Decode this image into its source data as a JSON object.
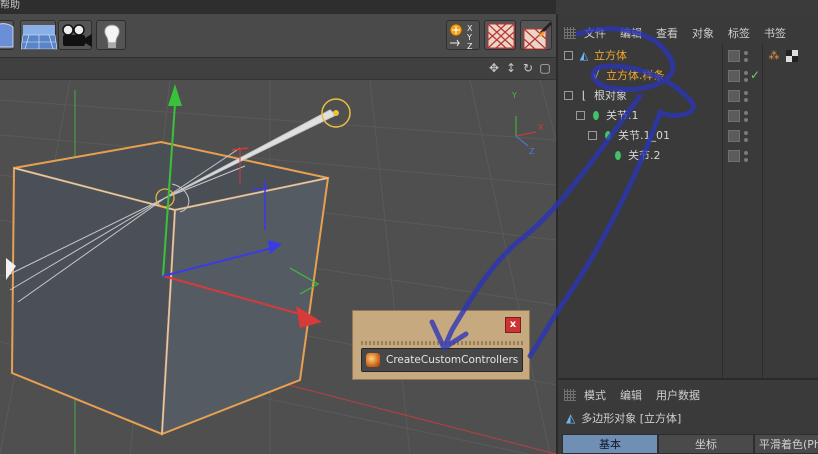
{
  "menubar": {
    "label": "帮助"
  },
  "viewport": {
    "axis_labels": {
      "x": "X",
      "y": "Y",
      "z": "Z"
    }
  },
  "object_manager": {
    "menu": [
      "文件",
      "编辑",
      "查看",
      "对象",
      "标签",
      "书签"
    ],
    "tree": [
      {
        "label": "立方体",
        "selected": true,
        "icon": "cube-icon"
      },
      {
        "label": "立方体.样条",
        "selected": true,
        "icon": "spline-icon",
        "checked": true
      },
      {
        "label": "根对象",
        "selected": false,
        "icon": "joint-root-icon"
      },
      {
        "label": "关节.1",
        "selected": false,
        "icon": "joint-icon"
      },
      {
        "label": "关节.1_01",
        "selected": false,
        "icon": "joint-icon"
      },
      {
        "label": "关节.2",
        "selected": false,
        "icon": "joint-icon"
      }
    ]
  },
  "attribute_manager": {
    "menu": [
      "模式",
      "编辑",
      "用户数据"
    ],
    "title": "多边形对象 [立方体]",
    "tabs": [
      "基本",
      "坐标",
      "平滑着色(Pho"
    ],
    "active_tab": "基本"
  },
  "dialog": {
    "close_label": "x",
    "button_label": "CreateCustomControllers"
  },
  "colors": {
    "accent_selected": "#f0a830",
    "active_tab": "#6f8fb5",
    "dialog_bg": "#c7a97f",
    "annotation_stroke": "#2b35b8"
  }
}
